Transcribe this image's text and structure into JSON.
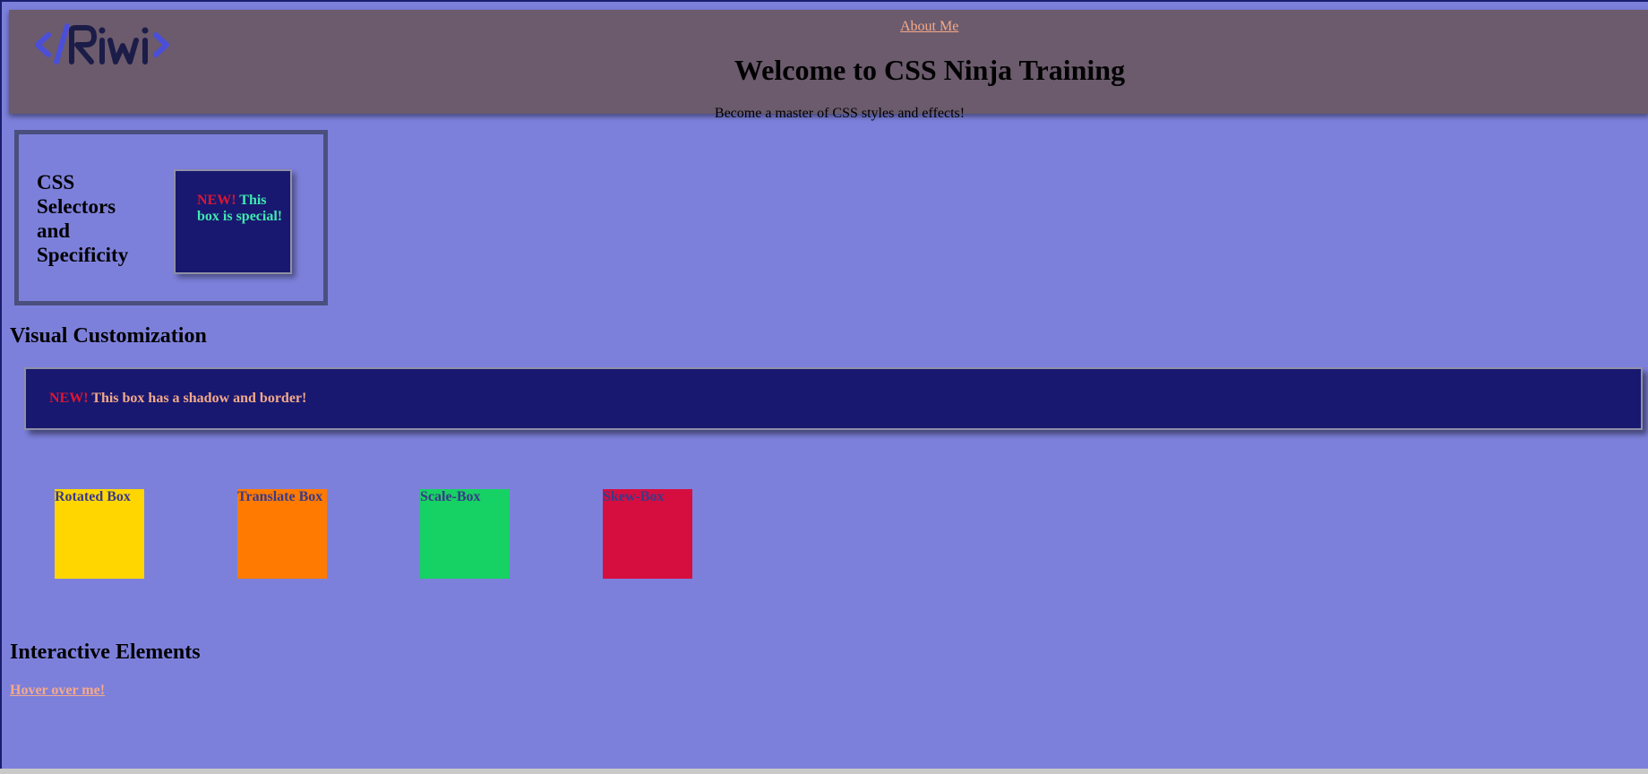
{
  "header": {
    "logo_text": "</Riwi>",
    "nav_link": "About Me",
    "title": "Welcome to CSS Ninja Training",
    "subtitle": "Become a master of CSS styles and effects!"
  },
  "selectors_section": {
    "heading": "CSS Selectors and Specificity",
    "box_badge": "NEW!",
    "box_text": "This box is special!"
  },
  "visual_section": {
    "heading": "Visual Customization",
    "box_badge": "NEW!",
    "box_text": "This box has a shadow and border!",
    "transform_boxes": {
      "rotate": "Rotated Box",
      "translate": "Translate Box",
      "scale": "Scale-Box",
      "skew": "Skew-Box"
    }
  },
  "interactive_section": {
    "heading": "Interactive Elements",
    "hover_link": "Hover over me!"
  },
  "colors": {
    "page_background": "#7d80db",
    "header_background": "#6b5b6d",
    "box_background": "#181870",
    "link": "#f4a98a",
    "badge_new": "#e0142f",
    "special_text": "#40e8b0",
    "rotate_box": "#ffd600",
    "translate_box": "#ff7a00",
    "scale_box": "#16d164",
    "skew_box": "#d60e40"
  }
}
